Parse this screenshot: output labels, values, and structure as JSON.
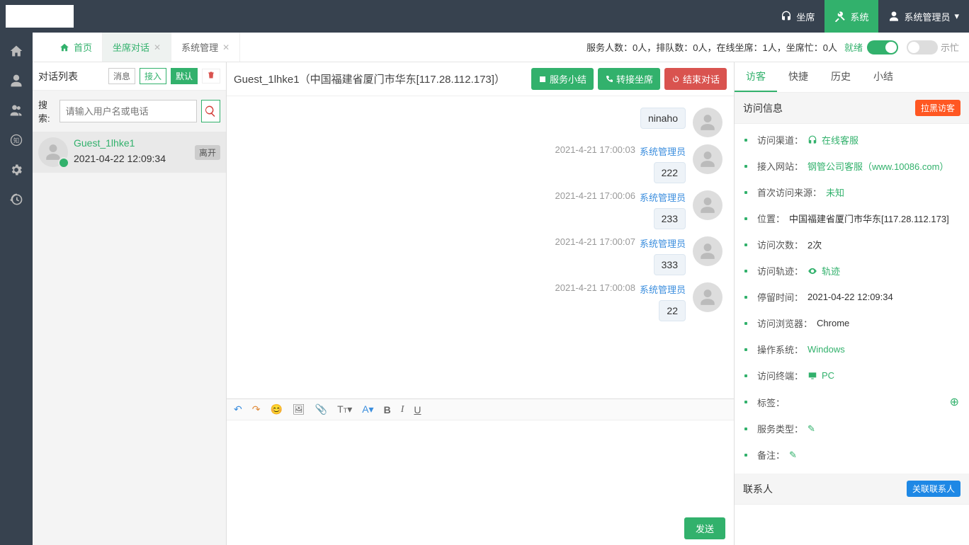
{
  "top": {
    "seat": "坐席",
    "system": "系统",
    "admin": "系统管理员"
  },
  "tabs": {
    "home": "首页",
    "chat": "坐席对话",
    "admin": "系统管理"
  },
  "status": {
    "text": "服务人数：0人，排队数：0人，在线坐席：1人，坐席忙：0人",
    "ready": "就绪",
    "busy": "示忙"
  },
  "list": {
    "title": "对话列表",
    "msg": "消息",
    "in": "接入",
    "default": "默认",
    "search_label": "搜索:",
    "search_placeholder": "请输入用户名或电话",
    "conv": {
      "name": "Guest_1lhke1",
      "time": "2021-04-22 12:09:34",
      "leave": "离开"
    }
  },
  "chat": {
    "title": "Guest_1lhke1（中国福建省厦门市华东[117.28.112.173]）",
    "btn_summary": "服务小结",
    "btn_transfer": "转接坐席",
    "btn_end": "结束对话",
    "send": "发送",
    "messages": [
      {
        "time": "",
        "who": "",
        "text": "ninaho"
      },
      {
        "time": "2021-4-21 17:00:03",
        "who": "系统管理员",
        "text": "222"
      },
      {
        "time": "2021-4-21 17:00:06",
        "who": "系统管理员",
        "text": "233"
      },
      {
        "time": "2021-4-21 17:00:07",
        "who": "系统管理员",
        "text": "333"
      },
      {
        "time": "2021-4-21 17:00:08",
        "who": "系统管理员",
        "text": "22"
      }
    ]
  },
  "info": {
    "tabs": {
      "visitor": "访客",
      "quick": "快捷",
      "history": "历史",
      "summary": "小结"
    },
    "visit_title": "访问信息",
    "blacklist": "拉黑访客",
    "channel_l": "访问渠道：",
    "channel_v": "在线客服",
    "site_l": "接入网站：",
    "site_v": "钢管公司客服（www.10086.com）",
    "first_l": "首次访问来源：",
    "first_v": "未知",
    "loc_l": "位置：",
    "loc_v": "中国福建省厦门市华东[117.28.112.173]",
    "count_l": "访问次数：",
    "count_v": "2次",
    "trace_l": "访问轨迹：",
    "trace_v": "轨迹",
    "stay_l": "停留时间：",
    "stay_v": "2021-04-22 12:09:34",
    "browser_l": "访问浏览器：",
    "browser_v": "Chrome",
    "os_l": "操作系统：",
    "os_v": "Windows",
    "term_l": "访问终端：",
    "term_v": "PC",
    "tag_l": "标签：",
    "type_l": "服务类型：",
    "note_l": "备注：",
    "contacts_title": "联系人",
    "contacts_link": "关联联系人"
  }
}
